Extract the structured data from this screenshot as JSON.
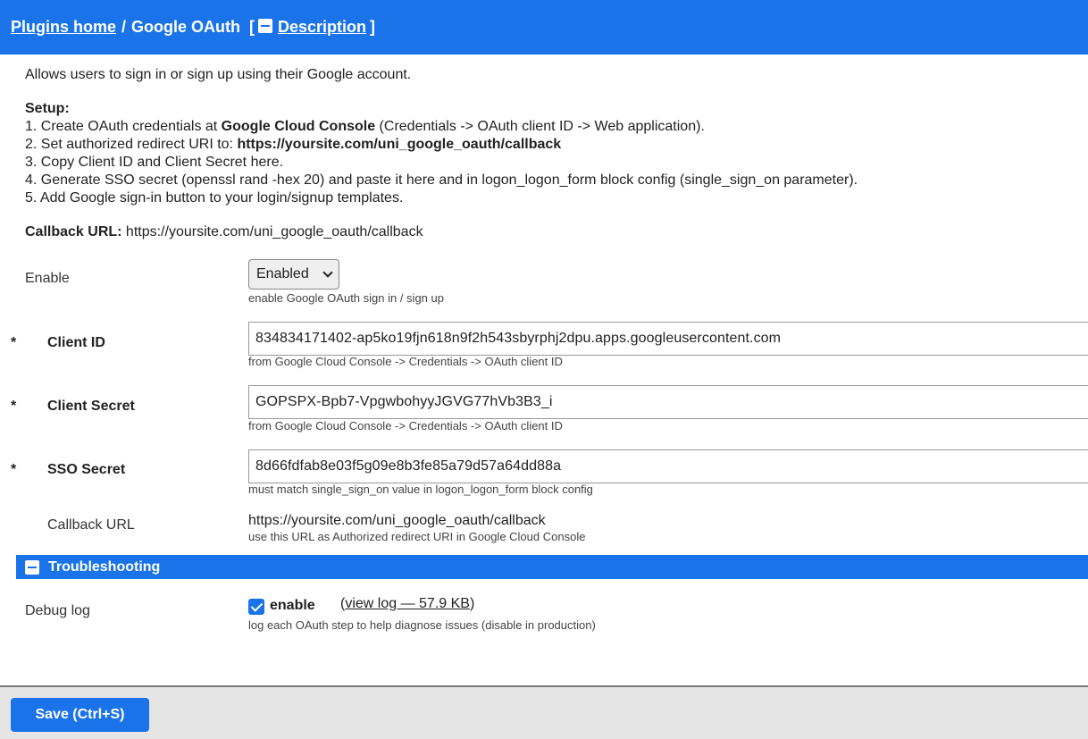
{
  "header": {
    "breadcrumb_home": "Plugins home",
    "separator": "/",
    "plugin_name": "Google OAuth",
    "bracket_open": "[",
    "description_toggle": "Description",
    "bracket_close": "]"
  },
  "description": {
    "intro": "Allows users to sign in or sign up using their Google account.",
    "setup_title": "Setup:",
    "step1_prefix": "1. Create OAuth credentials at ",
    "step1_bold": "Google Cloud Console",
    "step1_suffix": " (Credentials -> OAuth client ID -> Web application).",
    "step2_prefix": "2. Set authorized redirect URI to: ",
    "step2_bold": "https://yoursite.com/uni_google_oauth/callback",
    "step3": "3. Copy Client ID and Client Secret here.",
    "step4": "4. Generate SSO secret (openssl rand -hex 20) and paste it here and in logon_logon_form block config (single_sign_on parameter).",
    "step5": "5. Add Google sign-in button to your login/signup templates.",
    "callback_label": "Callback URL:",
    "callback_value": " https://yoursite.com/uni_google_oauth/callback"
  },
  "fields": {
    "enable": {
      "label": "Enable",
      "value": "Enabled",
      "help": "enable Google OAuth sign in / sign up"
    },
    "client_id": {
      "required_marker": "*",
      "label": "Client ID",
      "value": "834834171402-ap5ko19fjn618n9f2h543sbyrphj2dpu.apps.googleusercontent.com",
      "help": "from Google Cloud Console -> Credentials -> OAuth client ID"
    },
    "client_secret": {
      "required_marker": "*",
      "label": "Client Secret",
      "value": "GOPSPX-Bpb7-VpgwbohyyJGVG77hVb3B3_i",
      "help": "from Google Cloud Console -> Credentials -> OAuth client ID"
    },
    "sso_secret": {
      "required_marker": "*",
      "label": "SSO Secret",
      "value": "8d66fdfab8e03f5g09e8b3fe85a79d57a64dd88a",
      "help": "must match single_sign_on value in logon_logon_form block config"
    },
    "callback_url": {
      "label": "Callback URL",
      "value": "https://yoursite.com/uni_google_oauth/callback",
      "help": "use this URL as Authorized redirect URI in Google Cloud Console"
    }
  },
  "troubleshooting": {
    "title": "Troubleshooting",
    "debug_log": {
      "label": "Debug log",
      "checkbox_label": "enable",
      "checked": true,
      "paren_open": "(",
      "view_log_link": "view log — 57.9 KB",
      "paren_close": ")",
      "help": "log each OAuth step to help diagnose issues (disable in production)"
    }
  },
  "footer": {
    "save_label": "Save (Ctrl+S)"
  },
  "colors": {
    "accent": "#1a73e8",
    "footer_bg": "#e5e5e5"
  }
}
